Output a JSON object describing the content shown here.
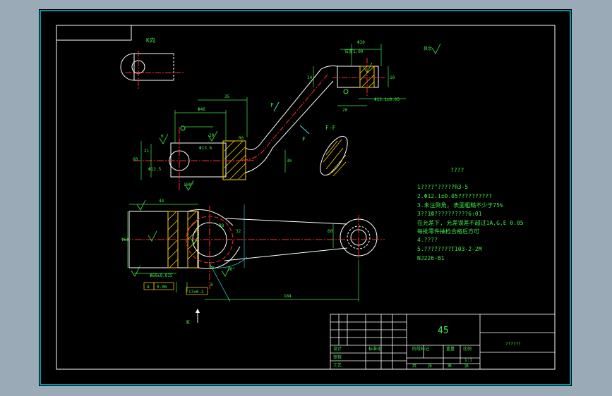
{
  "drawing": {
    "view_k_label": "K向",
    "arrow_k_label": "K",
    "section_label": "F-F",
    "force_label_1": "F",
    "force_label_2": "F",
    "roughness_note": "其余",
    "dims": {
      "d_top_width": "Φ30",
      "d_top_pos": "位置1.00",
      "d_14": "14",
      "d_10": "10",
      "d_20": "20",
      "d_hole": "Φ13.1±0.05",
      "d_length_top": "35",
      "d_phi_top": "Φ46",
      "d_60": "60",
      "d_phi13": "Φ13.6",
      "d_20b": "20",
      "d_21": "21",
      "d_phi_left": "Φ12.5",
      "d_6": "6",
      "d_100": "100°",
      "d_r6": "R6",
      "d_right_30": "30",
      "d_bottom_44": "44",
      "d_bottom_l": "Φ60",
      "d_bottom_len": "184",
      "d_bottom_60": "60",
      "d_bottom_tol1": "Φ60±0.015",
      "d_box1": "A",
      "d_box2": "0.06",
      "d_box3": "17±0.2",
      "d_angle": "30°",
      "d_r8": "R8",
      "d_32": "32",
      "d_20c": "20",
      "d_right_8": "8"
    },
    "notes_title": "????",
    "notes": [
      "1????\"?????R3-5",
      "2.Φ12.1±0.05??????????",
      "3.未注倒角, 表面粗糙不少于75%",
      "3??1Ю??????????6:01",
      "  在允差下, 允差误差不超过1A,G,E 0.05",
      "  每批零件抽检合格后方可",
      "4.????",
      "5.????????T103-2-2M",
      "  NJ226-B1"
    ],
    "title_block": {
      "material": "45",
      "part_name": "??????",
      "labels": {
        "designer": "设计",
        "standard": "标准化",
        "stage": "阶段标记",
        "weight": "重量",
        "scale": "比例",
        "review": "审核",
        "process": "工艺",
        "ratio": "1:1",
        "sheet": "共",
        "page": "第",
        "sheet_unit": "张",
        "page_unit": "张"
      }
    }
  },
  "colors": {
    "frame": "#ffffff",
    "border_cyan": "#00c8dc",
    "geometry": "#ffffff",
    "dimension": "#3fe84a",
    "center_line": "#ff2b2b",
    "hatch": "#ffd400",
    "page_bg": "#9aaab6"
  }
}
